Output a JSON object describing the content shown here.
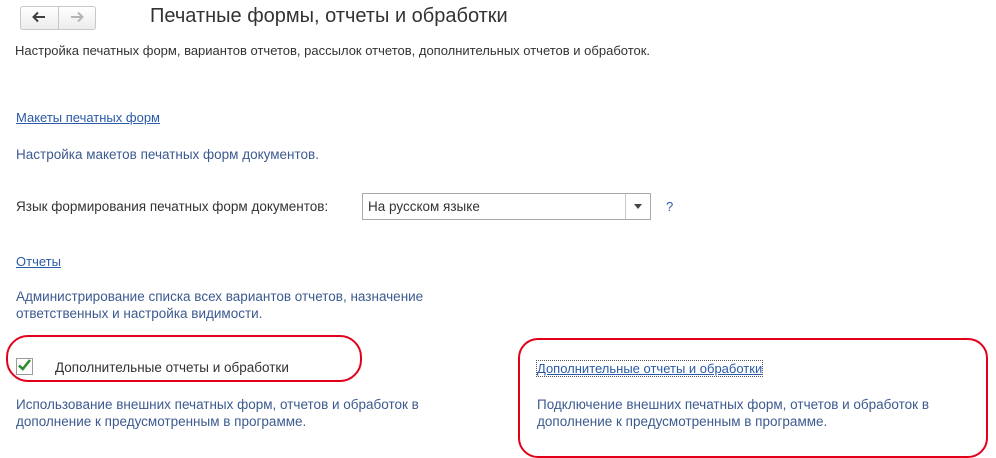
{
  "nav": {
    "back_icon": "arrow-left-icon",
    "forward_icon": "arrow-right-icon",
    "back_glyph": "🡐",
    "forward_glyph": "🡒"
  },
  "header": {
    "title": "Печатные формы, отчеты и обработки",
    "description": "Настройка печатных форм, вариантов отчетов, рассылок отчетов, дополнительных отчетов и обработок."
  },
  "print_layouts": {
    "link": "Макеты печатных форм",
    "note": "Настройка макетов печатных форм документов."
  },
  "language": {
    "label": "Язык формирования печатных форм документов:",
    "value": "На русском языке",
    "help": "?"
  },
  "reports": {
    "link": "Отчеты",
    "note_line1": "Администрирование списка всех вариантов отчетов, назначение",
    "note_line2": "ответственных и настройка видимости."
  },
  "additional": {
    "checkbox_label": "Дополнительные отчеты и обработки",
    "checked": true,
    "note_line1": "Использование внешних печатных форм, отчетов и обработок в",
    "note_line2": "дополнение к предусмотренным в программе.",
    "link": "Дополнительные отчеты и обработки",
    "link_note_line1": "Подключение внешних печатных форм, отчетов и обработок в",
    "link_note_line2": "дополнение к предусмотренным в программе."
  },
  "colors": {
    "link": "#2a5aa8",
    "note": "#3c5a8f",
    "annotation": "#e2001a",
    "check": "#2e8b2e"
  }
}
